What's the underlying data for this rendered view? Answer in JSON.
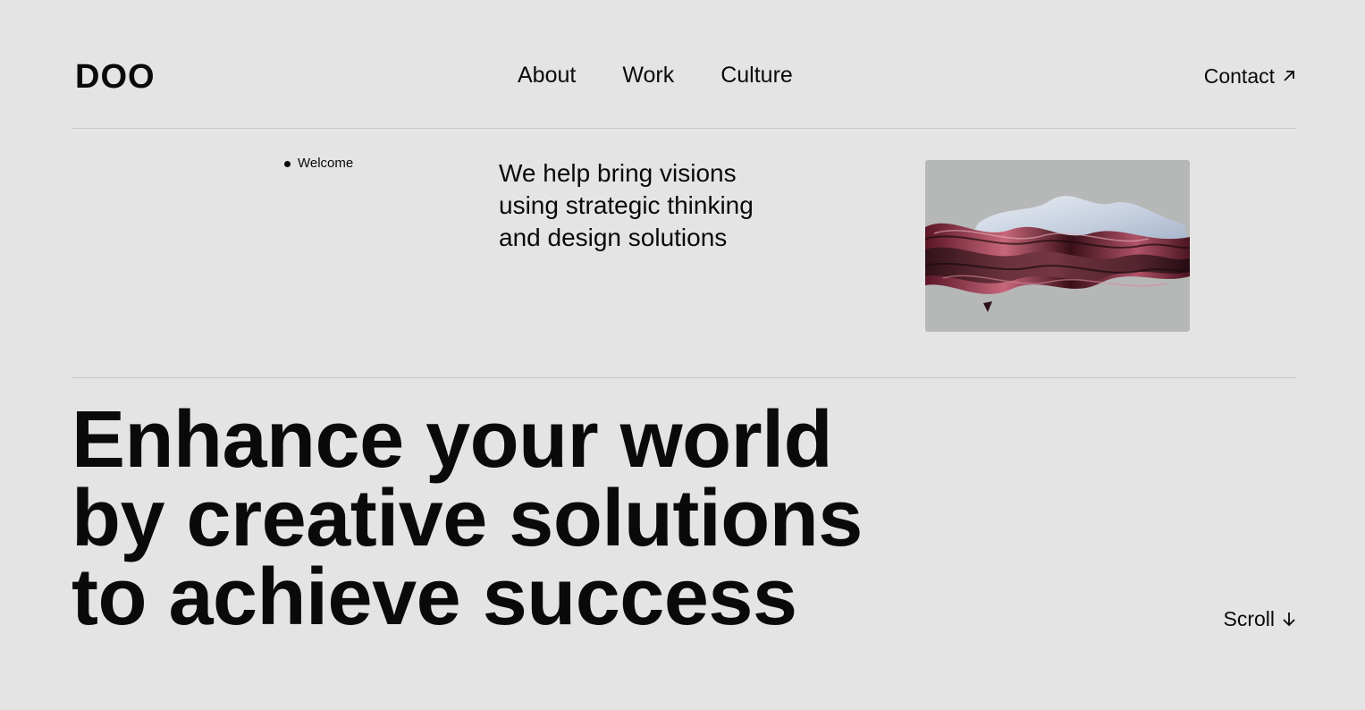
{
  "header": {
    "logo": "DOO",
    "nav": [
      "About",
      "Work",
      "Culture"
    ],
    "contact_label": "Contact"
  },
  "intro": {
    "eyebrow": "Welcome",
    "lines": [
      "We help bring visions",
      "using strategic thinking",
      "and design solutions"
    ]
  },
  "hero": {
    "headline_lines": [
      "Enhance your world",
      "by creative solutions",
      "to achieve success"
    ],
    "scroll_label": "Scroll"
  },
  "colors": {
    "background": "#e4e4e4",
    "text": "#0a0a0a",
    "rule": "#c8c8c8",
    "image_bg": "#b6b7b7"
  },
  "icons": {
    "contact": "arrow-up-right-icon",
    "scroll": "arrow-down-icon"
  }
}
